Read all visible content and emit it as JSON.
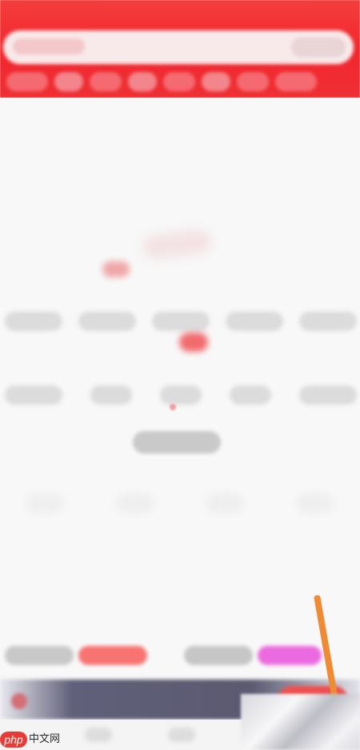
{
  "watermark": {
    "primary": "php",
    "secondary": "中文网"
  },
  "colors": {
    "header": "#ef2f35",
    "accent_orange": "#ef8a35",
    "pink_button": "#ec6adf",
    "red_button": "#f87472"
  }
}
